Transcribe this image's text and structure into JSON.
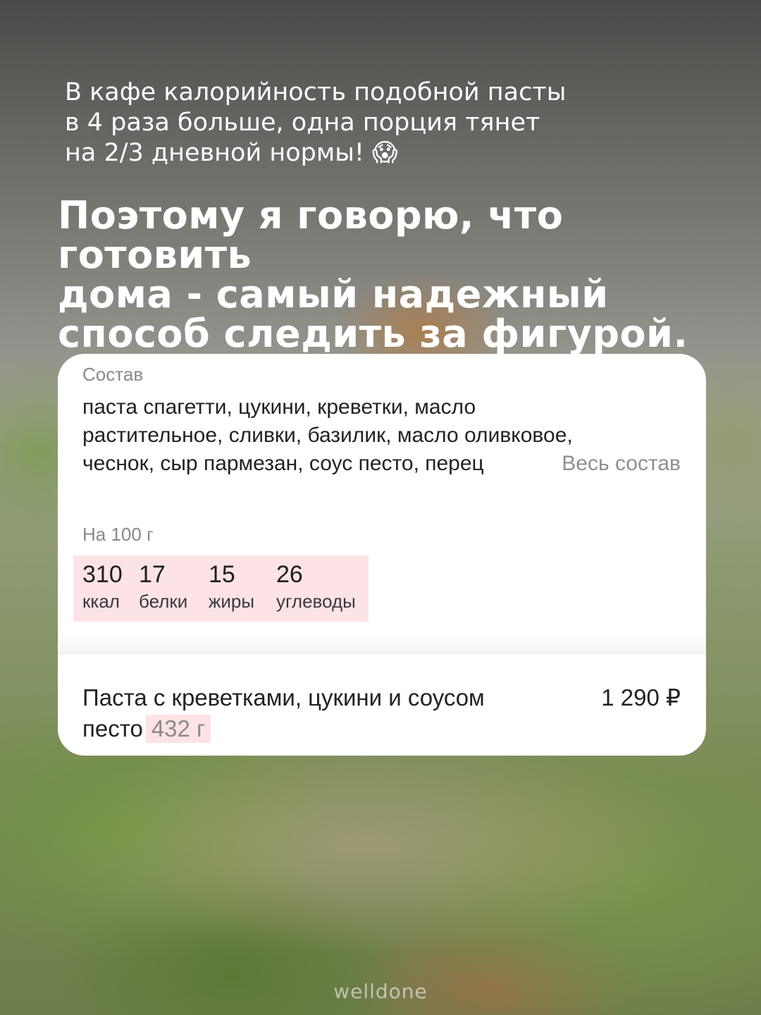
{
  "intro": {
    "line1": "В кафе калорийность подобной пасты",
    "line2": "в 4 раза больше, одна порция тянет",
    "line3": "на 2/3 дневной нормы! 😱"
  },
  "headline": {
    "line1": "Поэтому я говорю, что готовить",
    "line2": "дома - самый надежный",
    "line3": "способ следить за фигурой."
  },
  "card": {
    "composition_label": "Состав",
    "composition_line1": "паста спагетти, цукини, креветки, масло",
    "composition_line2": "растительное, сливки, базилик, масло оливковое,",
    "composition_line3": "чеснок, сыр пармезан, соус песто, перец",
    "full_composition_link": "Весь состав",
    "per_label": "На 100 г",
    "nutrition": [
      {
        "value": "310",
        "label": "ккал"
      },
      {
        "value": "17",
        "label": "белки"
      },
      {
        "value": "15",
        "label": "жиры"
      },
      {
        "value": "26",
        "label": "углеводы"
      }
    ],
    "product_name_line1": "Паста с креветками, цукини и соусом",
    "product_name_line2": "песто",
    "weight": "432 г",
    "price": "1 290 ₽"
  },
  "watermark": "welldone"
}
